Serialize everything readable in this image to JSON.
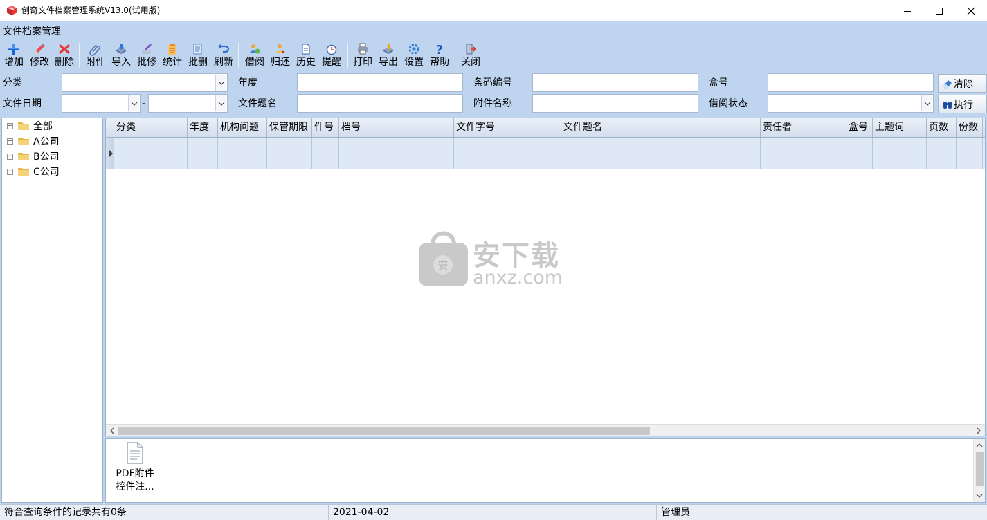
{
  "window": {
    "title": "创奇文件档案管理系统V13.0(试用版)",
    "controls": [
      "minimize-icon",
      "maximize-icon",
      "close-icon"
    ]
  },
  "menu_title": "文件档案管理",
  "toolbar": {
    "items": [
      {
        "label": "增加",
        "icon": "plus-icon"
      },
      {
        "label": "修改",
        "icon": "pencil-icon"
      },
      {
        "label": "删除",
        "icon": "delete-x-icon"
      },
      {
        "label": "附件",
        "icon": "paperclip-icon"
      },
      {
        "label": "导入",
        "icon": "import-icon"
      },
      {
        "label": "批修",
        "icon": "batch-edit-icon"
      },
      {
        "label": "统计",
        "icon": "statistics-icon"
      },
      {
        "label": "批删",
        "icon": "batch-delete-icon"
      },
      {
        "label": "刷新",
        "icon": "refresh-icon"
      },
      {
        "label": "借阅",
        "icon": "borrow-icon"
      },
      {
        "label": "归还",
        "icon": "return-icon"
      },
      {
        "label": "历史",
        "icon": "history-icon"
      },
      {
        "label": "提醒",
        "icon": "reminder-clock-icon"
      },
      {
        "label": "打印",
        "icon": "printer-icon"
      },
      {
        "label": "导出",
        "icon": "export-icon"
      },
      {
        "label": "设置",
        "icon": "settings-icon"
      },
      {
        "label": "帮助",
        "icon": "help-icon"
      },
      {
        "label": "关闭",
        "icon": "exit-icon"
      }
    ]
  },
  "filters": {
    "category_label": "分类",
    "category_value": "",
    "year_label": "年度",
    "year_value": "",
    "barcode_label": "条码编号",
    "barcode_value": "",
    "box_label": "盒号",
    "box_value": "",
    "clear_button": "清除",
    "file_date_label": "文件日期",
    "date_from": "",
    "date_separator": "-",
    "date_to": "",
    "doc_title_label": "文件题名",
    "doc_title_value": "",
    "attachment_name_label": "附件名称",
    "attachment_name_value": "",
    "borrow_status_label": "借阅状态",
    "borrow_status_value": "",
    "execute_button": "执行"
  },
  "tree": {
    "nodes": [
      {
        "label": "全部"
      },
      {
        "label": "A公司"
      },
      {
        "label": "B公司"
      },
      {
        "label": "C公司"
      }
    ]
  },
  "grid": {
    "columns": [
      "分类",
      "年度",
      "机构问题",
      "保管期限",
      "件号",
      "档号",
      "文件字号",
      "文件题名",
      "责任者",
      "盒号",
      "主题词",
      "页数",
      "份数"
    ],
    "rows": []
  },
  "watermark": {
    "cn": "安下载",
    "en": "anxz.com",
    "badge": "安"
  },
  "attachment": {
    "items": [
      {
        "line1": "PDF附件",
        "line2": "控件注..."
      }
    ]
  },
  "status": {
    "record_count": "符合查询条件的记录共有0条",
    "date": "2021-04-02",
    "user": "管理员"
  }
}
